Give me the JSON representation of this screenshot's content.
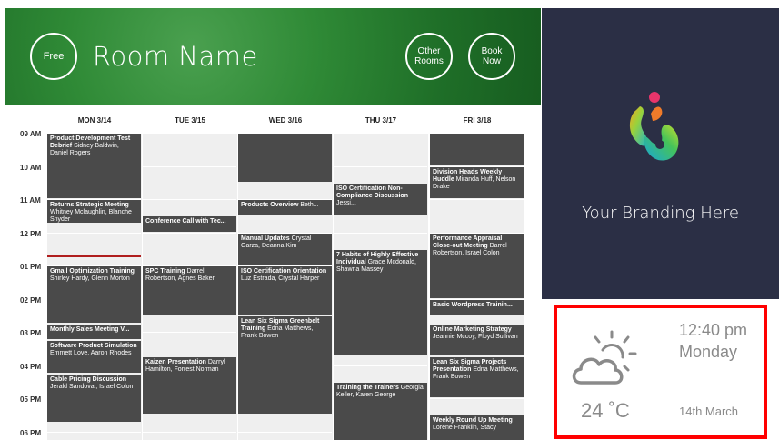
{
  "header": {
    "status_label": "Free",
    "room_name": "Room Name",
    "other_rooms_label": "Other\nRooms",
    "book_now_label": "Book\nNow"
  },
  "branding": {
    "text": "Your Branding Here"
  },
  "weather": {
    "time": "12:40 pm",
    "day": "Monday",
    "temperature": "24 ˚C",
    "date": "14th March",
    "icon": "partly-cloudy-icon"
  },
  "calendar": {
    "days": [
      "MON 3/14",
      "TUE 3/15",
      "WED 3/16",
      "THU 3/17",
      "FRI 3/18"
    ],
    "times": [
      "09 AM",
      "10 AM",
      "11 AM",
      "12 PM",
      "01 PM",
      "02 PM",
      "03 PM",
      "04 PM",
      "05 PM",
      "06 PM"
    ],
    "events": [
      {
        "day": 0,
        "start": 9.0,
        "end": 11.0,
        "title": "Product Development Test Debrief",
        "people": "Sidney Baldwin, Daniel Rogers"
      },
      {
        "day": 0,
        "start": 11.0,
        "end": 11.75,
        "title": "Returns Strategic Meeting",
        "people": "Whitney Mclaughlin, Blanche Snyder"
      },
      {
        "day": 0,
        "start": 13.0,
        "end": 14.75,
        "title": "Gmail Optimization Training",
        "people": "Shirley Hardy, Glenn Morton"
      },
      {
        "day": 0,
        "start": 14.75,
        "end": 15.25,
        "title": "Monthly Sales Meeting V...",
        "people": ""
      },
      {
        "day": 0,
        "start": 15.25,
        "end": 16.25,
        "title": "Software Product Simulation",
        "people": "Emmett Love, Aaron Rhodes"
      },
      {
        "day": 0,
        "start": 16.25,
        "end": 17.75,
        "title": "Cable Pricing Discussion",
        "people": "Jerald Sandoval, Israel Colon"
      },
      {
        "day": 1,
        "start": 11.5,
        "end": 12.0,
        "title": "Conference Call with Tec...",
        "people": ""
      },
      {
        "day": 1,
        "start": 13.0,
        "end": 14.5,
        "title": "SPC Training",
        "people": "Darrel Robertson, Agnes Baker"
      },
      {
        "day": 1,
        "start": 15.75,
        "end": 17.5,
        "title": "Kaizen Presentation",
        "people": "Darryl Hamilton, Forrest Norman"
      },
      {
        "day": 2,
        "start": 9.0,
        "end": 10.5,
        "title": "",
        "people": ""
      },
      {
        "day": 2,
        "start": 11.0,
        "end": 11.5,
        "title": "Products Overview",
        "people": "Beth..."
      },
      {
        "day": 2,
        "start": 12.0,
        "end": 13.0,
        "title": "Manual Updates",
        "people": "Crystal Garza, Deanna Kim"
      },
      {
        "day": 2,
        "start": 13.0,
        "end": 14.5,
        "title": "ISO Certification Orientation",
        "people": "Luz Estrada, Crystal Harper"
      },
      {
        "day": 2,
        "start": 14.5,
        "end": 17.5,
        "title": "Lean Six Sigma Greenbelt Training",
        "people": "Edna Matthews, Frank Bowen"
      },
      {
        "day": 3,
        "start": 10.5,
        "end": 11.5,
        "title": "ISO Certification Non-Compliance Discussion",
        "people": "Jessi..."
      },
      {
        "day": 3,
        "start": 12.5,
        "end": 15.75,
        "title": "7 Habits of Highly Effective Individual",
        "people": "Grace Mcdonald, Shawna Massey"
      },
      {
        "day": 3,
        "start": 16.5,
        "end": 18.5,
        "title": "Training the Trainers",
        "people": "Georgia Keller, Karen George"
      },
      {
        "day": 4,
        "start": 9.0,
        "end": 10.0,
        "title": "",
        "people": ""
      },
      {
        "day": 4,
        "start": 10.0,
        "end": 11.0,
        "title": "Division Heads Weekly Huddle",
        "people": "Miranda Huff, Nelson Drake"
      },
      {
        "day": 4,
        "start": 12.0,
        "end": 14.0,
        "title": "Performance Appraisal Close-out Meeting",
        "people": "Darrel Robertson, Israel Colon"
      },
      {
        "day": 4,
        "start": 14.0,
        "end": 14.5,
        "title": "Basic Wordpress Trainin...",
        "people": ""
      },
      {
        "day": 4,
        "start": 14.75,
        "end": 15.75,
        "title": "Online Marketing Strategy",
        "people": "Jeannie Mccoy, Floyd Sullivan"
      },
      {
        "day": 4,
        "start": 15.75,
        "end": 17.0,
        "title": "Lean Six Sigma Projects Presentation",
        "people": "Edna Matthews, Frank Bowen"
      },
      {
        "day": 4,
        "start": 17.5,
        "end": 18.5,
        "title": "Weekly Round Up Meeting",
        "people": "Lorene Franklin, Stacy"
      }
    ]
  }
}
